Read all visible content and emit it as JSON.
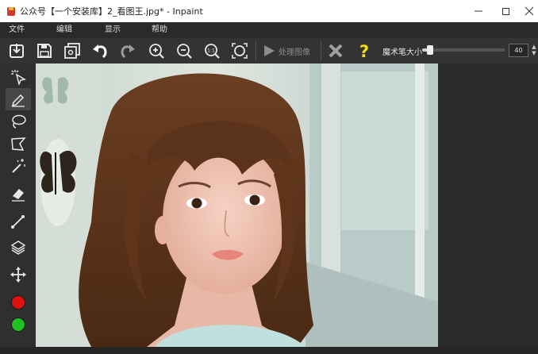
{
  "window": {
    "title": "公众号【一个安装库】2_看图王.jpg* - Inpaint"
  },
  "menu": {
    "items": [
      "文件",
      "编辑",
      "显示",
      "帮助"
    ]
  },
  "toolbar": {
    "buttons": [
      "import-icon",
      "save-icon",
      "save-as-icon",
      "undo-icon",
      "redo-icon",
      "zoom-in-icon",
      "zoom-out-icon",
      "actual-size-icon",
      "fit-window-icon",
      "process-icon",
      "cancel-icon",
      "help-icon"
    ],
    "process_label": "处理图像",
    "brush_size_label": "魔术笔大小",
    "brush_size_value": "40",
    "brush_size_fraction": 0.1
  },
  "tools": {
    "items": [
      "marker-select-icon",
      "pencil-icon",
      "lasso-icon",
      "polygon-lasso-icon",
      "magic-wand-icon",
      "eraser-icon",
      "line-icon",
      "layers-icon",
      "move-icon"
    ],
    "active": "pencil-icon",
    "colors": [
      "#e01010",
      "#20c020"
    ]
  }
}
